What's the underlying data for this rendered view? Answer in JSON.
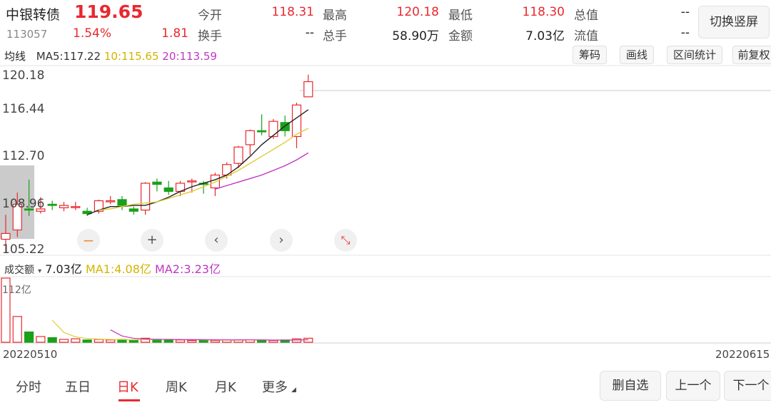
{
  "header": {
    "name": "中银转债",
    "price": "119.65",
    "code": "113057",
    "change_pct": "1.54%",
    "change": "1.81",
    "quote": [
      {
        "label": "今开",
        "value": "118.31",
        "color": "red"
      },
      {
        "label": "最高",
        "value": "120.18",
        "color": "red"
      },
      {
        "label": "最低",
        "value": "118.30",
        "color": "red"
      },
      {
        "label": "总值",
        "value": "--",
        "color": "dark"
      },
      {
        "label": "换手",
        "value": "--",
        "color": "dark"
      },
      {
        "label": "总手",
        "value": "58.90万",
        "color": "dark"
      },
      {
        "label": "金额",
        "value": "7.03亿",
        "color": "dark"
      },
      {
        "label": "流值",
        "value": "--",
        "color": "dark"
      }
    ],
    "portrait_button": "切换竖屏"
  },
  "ma": {
    "title": "均线",
    "ma5": "MA5:117.22",
    "ma10": "10:115.65",
    "ma20": "20:113.59"
  },
  "tools": [
    "筹码",
    "画线",
    "区间统计",
    "前复权"
  ],
  "price_axis": [
    "120.18",
    "116.44",
    "112.70",
    "108.96",
    "105.22"
  ],
  "volume": {
    "title": "成交额",
    "value": "7.03亿",
    "ma1": "MA1:4.08亿",
    "ma2": "MA2:3.23亿",
    "max_label": "112亿"
  },
  "dates": {
    "start": "20220510",
    "end": "20220615"
  },
  "tabs": [
    "分时",
    "五日",
    "日K",
    "周K",
    "月K",
    "更多"
  ],
  "active_tab": "日K",
  "bottom_buttons": [
    "删自选",
    "上一个",
    "下一个"
  ],
  "controls": [
    "zoom-out",
    "zoom-in",
    "previous",
    "next",
    "collapse"
  ],
  "colors": {
    "up": "#e8292f",
    "down": "#1aa01a",
    "ma5": "#222222",
    "ma10": "#e0cc3a",
    "ma20": "#c136c1"
  },
  "chart_data": {
    "type": "candlestick",
    "price_range": [
      105.22,
      120.18
    ],
    "candles": [
      {
        "o": 106.1,
        "c": 106.6,
        "h": 108.2,
        "l": 105.0
      },
      {
        "o": 106.9,
        "c": 109.1,
        "h": 110.1,
        "l": 106.3
      },
      {
        "o": 108.7,
        "c": 108.6,
        "h": 111.2,
        "l": 108.1
      },
      {
        "o": 108.5,
        "c": 108.7,
        "h": 109.7,
        "l": 108.3
      },
      {
        "o": 109.1,
        "c": 109.0,
        "h": 109.4,
        "l": 108.6
      },
      {
        "o": 108.8,
        "c": 109.0,
        "h": 109.3,
        "l": 108.5
      },
      {
        "o": 108.9,
        "c": 108.9,
        "h": 109.3,
        "l": 108.6
      },
      {
        "o": 108.5,
        "c": 108.3,
        "h": 108.8,
        "l": 108.1
      },
      {
        "o": 108.5,
        "c": 109.4,
        "h": 109.5,
        "l": 108.3
      },
      {
        "o": 109.4,
        "c": 109.4,
        "h": 109.8,
        "l": 109.1
      },
      {
        "o": 109.5,
        "c": 109.0,
        "h": 109.8,
        "l": 108.6
      },
      {
        "o": 108.7,
        "c": 108.5,
        "h": 108.9,
        "l": 108.2
      },
      {
        "o": 108.6,
        "c": 110.9,
        "h": 111.0,
        "l": 108.2
      },
      {
        "o": 111.0,
        "c": 110.8,
        "h": 111.3,
        "l": 110.2
      },
      {
        "o": 110.5,
        "c": 110.2,
        "h": 111.1,
        "l": 109.9
      },
      {
        "o": 110.2,
        "c": 110.9,
        "h": 111.1,
        "l": 109.8
      },
      {
        "o": 111.1,
        "c": 111.1,
        "h": 111.3,
        "l": 110.1
      },
      {
        "o": 110.9,
        "c": 110.8,
        "h": 111.1,
        "l": 110.0
      },
      {
        "o": 110.5,
        "c": 111.6,
        "h": 111.8,
        "l": 109.8
      },
      {
        "o": 111.6,
        "c": 112.5,
        "h": 112.7,
        "l": 111.3
      },
      {
        "o": 112.6,
        "c": 114.0,
        "h": 114.1,
        "l": 112.2
      },
      {
        "o": 114.2,
        "c": 115.4,
        "h": 115.5,
        "l": 113.3
      },
      {
        "o": 115.4,
        "c": 115.3,
        "h": 116.8,
        "l": 115.0
      },
      {
        "o": 114.9,
        "c": 116.2,
        "h": 116.4,
        "l": 114.7
      },
      {
        "o": 116.1,
        "c": 115.4,
        "h": 116.7,
        "l": 114.9
      },
      {
        "o": 114.9,
        "c": 117.6,
        "h": 117.8,
        "l": 113.9
      },
      {
        "o": 118.3,
        "c": 119.6,
        "h": 120.2,
        "l": 118.3
      }
    ],
    "ma5": [
      108.2,
      108.6,
      108.9,
      108.9,
      109.0,
      109.0,
      109.3,
      109.7,
      110.2,
      110.6,
      110.9,
      111.2,
      111.6,
      112.3,
      113.2,
      114.2,
      115.0,
      115.8,
      116.5,
      117.2
    ],
    "ma10": [
      108.6,
      108.7,
      108.9,
      109.1,
      109.2,
      109.3,
      109.6,
      109.9,
      110.2,
      110.6,
      111.0,
      111.5,
      112.0,
      112.6,
      113.2,
      113.8,
      114.4,
      115.1,
      115.6
    ],
    "ma20": [
      110.4,
      110.7,
      111.0,
      111.3,
      111.6,
      112.0,
      112.4,
      112.9,
      113.5
    ],
    "volume": [
      112,
      45,
      18,
      10,
      8,
      5,
      6,
      4,
      5,
      4,
      5,
      3,
      7,
      5,
      5,
      4,
      3,
      4,
      3,
      4,
      4,
      4,
      4,
      3,
      4,
      6,
      7
    ],
    "volume_max": 112
  }
}
